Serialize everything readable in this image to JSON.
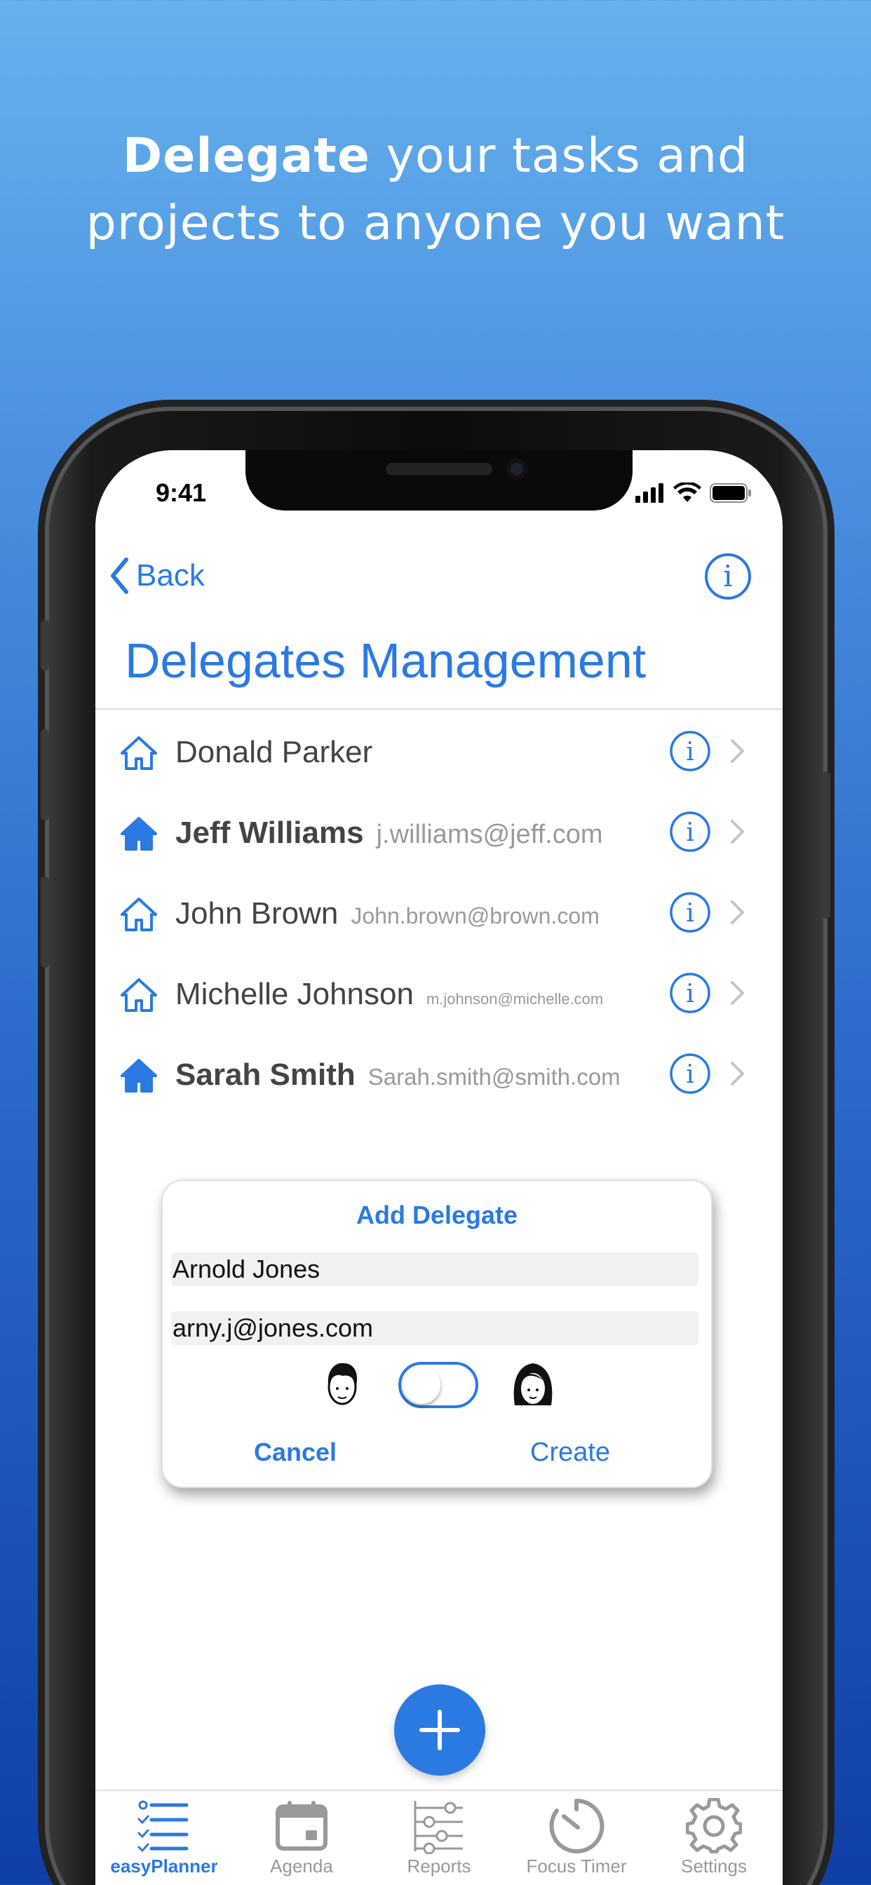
{
  "headline": {
    "bold": "Delegate",
    "line1_rest": " your tasks and",
    "line2": "projects to anyone you want"
  },
  "status": {
    "time": "9:41"
  },
  "nav": {
    "back_label": "Back"
  },
  "page_title": "Delegates Management",
  "delegates": [
    {
      "name": "Donald Parker",
      "email": "",
      "filled_icon": false,
      "bold": false
    },
    {
      "name": "Jeff Williams",
      "email": "j.williams@jeff.com",
      "filled_icon": true,
      "bold": true
    },
    {
      "name": "John Brown",
      "email": "John.brown@brown.com",
      "filled_icon": false,
      "bold": false
    },
    {
      "name": "Michelle Johnson",
      "email": "m.johnson@michelle.com",
      "filled_icon": false,
      "bold": false
    },
    {
      "name": "Sarah Smith",
      "email": "Sarah.smith@smith.com",
      "filled_icon": true,
      "bold": true
    }
  ],
  "dialog": {
    "title": "Add Delegate",
    "name_value": "Arnold Jones",
    "email_value": "arny.j@jones.com",
    "toggle_on": false,
    "cancel_label": "Cancel",
    "create_label": "Create"
  },
  "tabs": [
    {
      "label": "easyPlanner",
      "icon": "list-check-icon",
      "active": true
    },
    {
      "label": "Agenda",
      "icon": "calendar-icon",
      "active": false
    },
    {
      "label": "Reports",
      "icon": "sliders-icon",
      "active": false
    },
    {
      "label": "Focus Timer",
      "icon": "timer-icon",
      "active": false
    },
    {
      "label": "Settings",
      "icon": "gear-icon",
      "active": false
    }
  ],
  "colors": {
    "accent": "#2a7ae2",
    "text": "#444444",
    "muted": "#9a9a9a"
  }
}
